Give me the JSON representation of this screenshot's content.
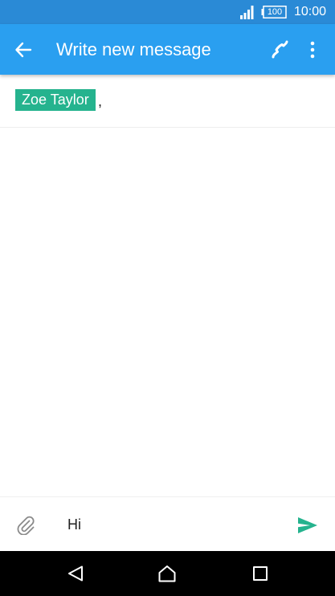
{
  "status_bar": {
    "battery_level": "100",
    "time": "10:00",
    "icons": [
      "signal-icon",
      "battery-icon"
    ]
  },
  "app_bar": {
    "title": "Write new message",
    "icons": [
      "back-arrow-icon",
      "phone-icon",
      "more-vert-icon"
    ]
  },
  "recipients": {
    "chips": [
      {
        "name": "Zoe Taylor"
      }
    ],
    "separator": ","
  },
  "compose": {
    "message_text": "Hi",
    "icons": [
      "paperclip-icon",
      "send-icon"
    ]
  },
  "navigation": {
    "icons": [
      "nav-back-icon",
      "nav-home-icon",
      "nav-recents-icon"
    ]
  },
  "colors": {
    "status_bar": "#2a8ad6",
    "app_bar": "#2a9ff0",
    "chip": "#25b38e",
    "send_icon": "#25b38e",
    "nav_bar": "#000000"
  }
}
